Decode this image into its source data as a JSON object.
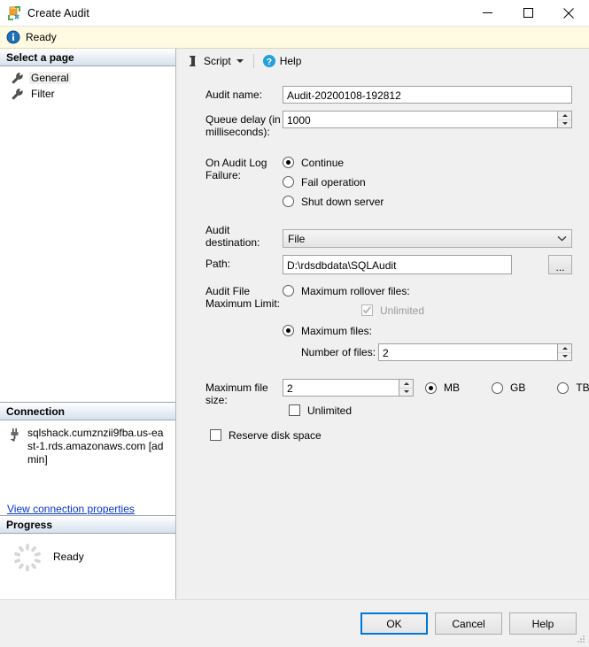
{
  "window": {
    "title": "Create Audit",
    "icon": "create-audit-icon",
    "controls": {
      "minimize": "minimize",
      "maximize": "maximize",
      "close": "close"
    }
  },
  "status_bar": {
    "icon": "info-icon",
    "text": "Ready"
  },
  "sidebar": {
    "select_page": {
      "header": "Select a page",
      "items": [
        {
          "label": "General",
          "icon": "wrench-icon",
          "selected": true
        },
        {
          "label": "Filter",
          "icon": "wrench-icon",
          "selected": false
        }
      ]
    },
    "connection": {
      "header": "Connection",
      "icon": "connection-icon",
      "server": "sqlshack.cumznzii9fba.us-east-1.rds.amazonaws.com [admin]",
      "link": "View connection properties"
    },
    "progress": {
      "header": "Progress",
      "icon": "spinner-icon",
      "status": "Ready"
    }
  },
  "toolbar": {
    "script_label": "Script",
    "script_icon": "script-icon",
    "help_label": "Help",
    "help_icon": "help-icon"
  },
  "form": {
    "audit_name": {
      "label": "Audit name:",
      "value": "Audit-20200108-192812"
    },
    "queue_delay": {
      "label": "Queue delay (in milliseconds):",
      "value": "1000"
    },
    "on_failure": {
      "label": "On Audit Log Failure:",
      "options": [
        "Continue",
        "Fail operation",
        "Shut down server"
      ],
      "selected": "Continue"
    },
    "audit_destination": {
      "label": "Audit destination:",
      "value": "File"
    },
    "path": {
      "label": "Path:",
      "value": "D:\\rdsdbdata\\SQLAudit",
      "browse_label": "..."
    },
    "max_limit": {
      "label": "Audit File Maximum Limit:",
      "rollover_option": "Maximum rollover files:",
      "rollover_unlimited": "Unlimited",
      "rollover_unlimited_checked": true,
      "rollover_unlimited_disabled": true,
      "maxfiles_option": "Maximum files:",
      "selected": "Maximum files:",
      "number_of_files_label": "Number of files:",
      "number_of_files_value": "2"
    },
    "max_file_size": {
      "label": "Maximum file size:",
      "value": "2",
      "units": [
        "MB",
        "GB",
        "TB"
      ],
      "selected_unit": "MB",
      "unlimited_label": "Unlimited",
      "unlimited_checked": false
    },
    "reserve_disk_space": {
      "label": "Reserve disk space",
      "checked": false
    }
  },
  "footer": {
    "ok": "OK",
    "cancel": "Cancel",
    "help": "Help"
  },
  "colors": {
    "accent": "#0078d7",
    "link": "#0033cc",
    "info_bg": "#fffbe3",
    "dialog_bg": "#f0f0f0"
  }
}
